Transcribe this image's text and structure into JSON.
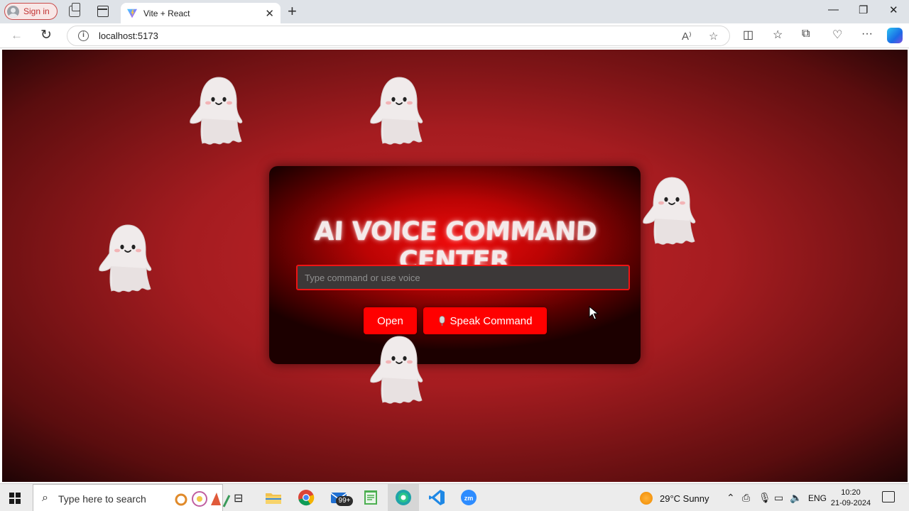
{
  "browser": {
    "signin_label": "Sign in",
    "tab_title": "Vite + React",
    "url": "localhost:5173"
  },
  "app": {
    "title": "AI VOICE COMMAND CENTER",
    "input_placeholder": "Type command or use voice",
    "open_label": "Open",
    "speak_label": "Speak Command"
  },
  "taskbar": {
    "search_placeholder": "Type here to search",
    "mail_badge": "99+",
    "weather": "29°C  Sunny",
    "language": "ENG",
    "time": "10:20",
    "date": "21-09-2024"
  },
  "colors": {
    "accent": "#ff0000",
    "background": "#c5262a",
    "card": "#bb0404"
  }
}
